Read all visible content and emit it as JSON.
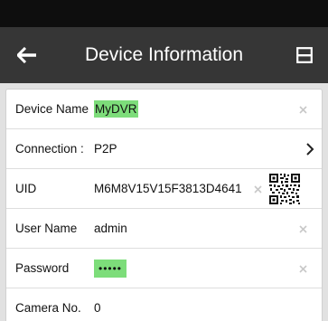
{
  "header": {
    "title": "Device Information",
    "back_icon": "arrow-left-icon",
    "save_icon": "save-icon"
  },
  "fields": {
    "device_name": {
      "label": "Device Name",
      "value": "MyDVR"
    },
    "connection": {
      "label": "Connection :",
      "value": "P2P"
    },
    "uid": {
      "label": "UID",
      "value": "M6M8V15V15F3813D4641"
    },
    "user_name": {
      "label": "User Name",
      "value": "admin"
    },
    "password": {
      "label": "Password",
      "value": "•••••"
    },
    "camera_no": {
      "label": "Camera No.",
      "value": "0"
    }
  },
  "colors": {
    "nav_bar": "#363636",
    "status_bar": "#0e0e0e",
    "highlight": "#7ddd7a",
    "panel_bg": "#e1e1e1"
  }
}
